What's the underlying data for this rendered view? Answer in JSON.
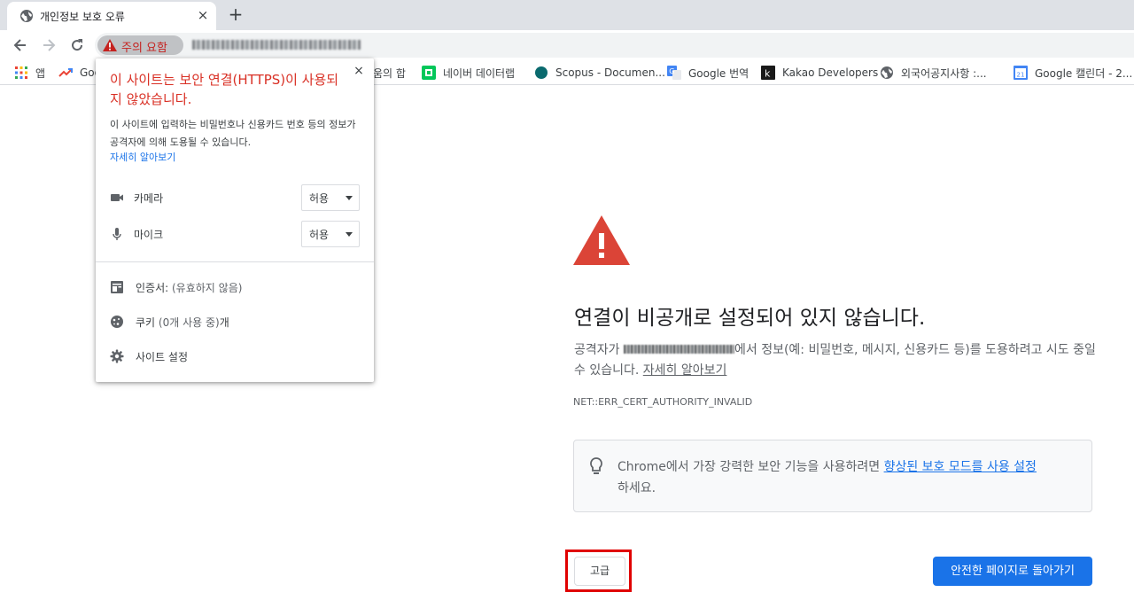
{
  "tab": {
    "title": "개인정보 보호 오류",
    "close": "×",
    "new_tab": "+"
  },
  "omnibox": {
    "security_chip": "주의 요함"
  },
  "bookmarks": [
    {
      "label": "앱",
      "icon": "apps-grid-icon"
    },
    {
      "label": "Goo",
      "icon": "trending-icon"
    },
    {
      "label": "움의 합",
      "icon": ""
    },
    {
      "label": "네이버 데이터랩",
      "icon": "naver-datalab-icon"
    },
    {
      "label": "Scopus - Documen...",
      "icon": "scopus-icon"
    },
    {
      "label": "Google 번역",
      "icon": "google-translate-icon"
    },
    {
      "label": "Kakao Developers",
      "icon": "kakao-icon"
    },
    {
      "label": "외국어공지사항 :...",
      "icon": "globe-icon"
    },
    {
      "label": "Google 캘린더 - 2...",
      "icon": "google-calendar-icon"
    }
  ],
  "popup": {
    "title": "이 사이트는 보안 연결(HTTPS)이 사용되지 않았습니다.",
    "body": "이 사이트에 입력하는 비밀번호나 신용카드 번호 등의 정보가 공격자에 의해 도용될 수 있습니다.",
    "learn_more": "자세히 알아보기",
    "close": "×",
    "permissions": [
      {
        "label": "카메라",
        "value": "허용",
        "icon": "camera-icon"
      },
      {
        "label": "마이크",
        "value": "허용",
        "icon": "mic-icon"
      }
    ],
    "certificate": {
      "label": "인증서:",
      "status": "(유효하지 않음)"
    },
    "cookies": {
      "label": "쿠키",
      "detail": "(0개 사용 중)",
      "suffix": "개"
    },
    "site_settings": "사이트 설정"
  },
  "page": {
    "heading": "연결이 비공개로 설정되어 있지 않습니다.",
    "desc_prefix": "공격자가 ",
    "desc_suffix": "에서 정보(예: 비밀번호, 메시지, 신용카드 등)를 도용하려고 시도 중일 수 있습니다. ",
    "learn_more": "자세히 알아보기",
    "error_code": "NET::ERR_CERT_AUTHORITY_INVALID",
    "tip_prefix": "Chrome에서 가장 강력한 보안 기능을 사용하려면 ",
    "tip_link": "향상된 보호 모드를 사용 설정",
    "tip_suffix": "하세요.",
    "advanced_button": "고급",
    "back_button": "안전한 페이지로 돌아가기"
  },
  "colors": {
    "danger": "#d93025",
    "primary": "#1a73e8",
    "annotation": "#e00000"
  }
}
